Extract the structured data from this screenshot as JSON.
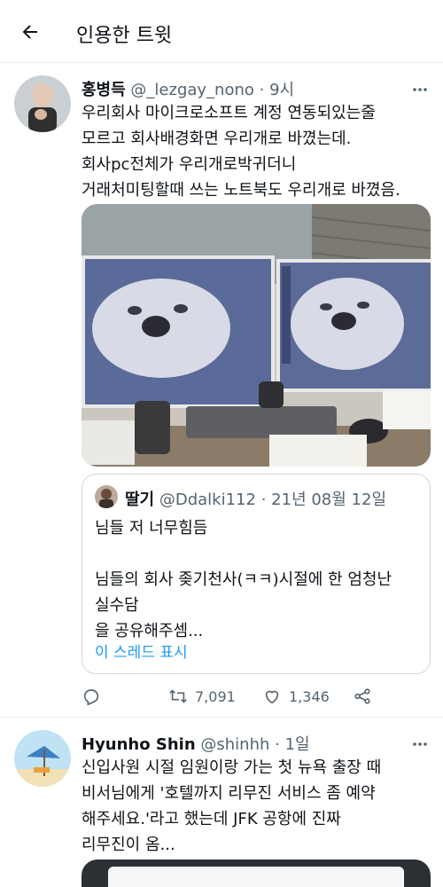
{
  "header": {
    "back_icon": "arrow-left-icon",
    "title": "인용한 트윗"
  },
  "tweets": [
    {
      "name": "홍병득",
      "handle": "@_lezgay_nono",
      "separator": "·",
      "time": "9시",
      "text": "우리회사 마이크로소프트 계정 연동되있는줄\n모르고 회사배경화면 우리개로 바꼈는데.\n회사pc전체가 우리개로박귀더니\n거래처미팅할때 쓰는 노트북도 우리개로 바꼈음.",
      "quote": {
        "name": "딸기",
        "handle": "@Ddalki112",
        "separator": "·",
        "date": "21년 08월 12일",
        "text": "님들 저 너무힘듬\n\n님들의 회사 좆기천사(ㅋㅋ)시절에 한 엄청난\n실수담\n을 공유해주셈...",
        "link": "이 스레드 표시"
      },
      "actions": {
        "reply_count": "",
        "retweet_count": "7,091",
        "like_count": "1,346"
      }
    },
    {
      "name": "Hyunho Shin",
      "handle": "@shinhh",
      "separator": "·",
      "time": "1일",
      "text": "신입사원 시절 임원이랑 가는 첫 뉴욕 출장 때\n비서님에게 '호텔까지 리무진 서비스 좀 예약\n해주세요.'라고 했는데 JFK 공항에 진짜\n리무진이 옴..."
    }
  ],
  "colors": {
    "accent": "#1d9bf0",
    "text": "#0f1419",
    "secondary": "#536471",
    "border": "#cfd9de"
  }
}
